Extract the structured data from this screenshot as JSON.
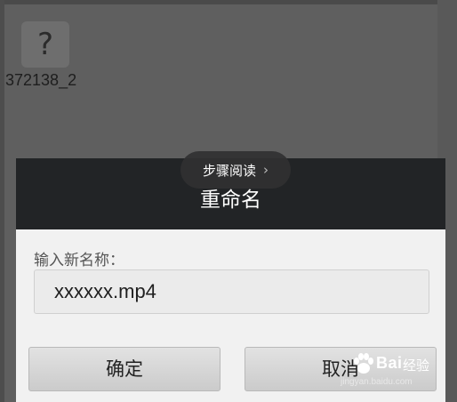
{
  "file_item": {
    "icon_glyph": "?",
    "name": "372138_2"
  },
  "dialog": {
    "title": "重命名",
    "prompt_label": "输入新名称：",
    "input_value": "xxxxxx.mp4",
    "confirm_label": "确定",
    "cancel_label": "取消"
  },
  "overlay": {
    "reading_label": "步骤阅读",
    "chevron": "›"
  },
  "watermark": {
    "brand": "Bai",
    "suffix": "经验",
    "url": "jingyan.baidu.com"
  },
  "colors": {
    "background": "#5f5f5f",
    "dialog_header": "#222426",
    "dialog_body": "#f1f1f1"
  }
}
